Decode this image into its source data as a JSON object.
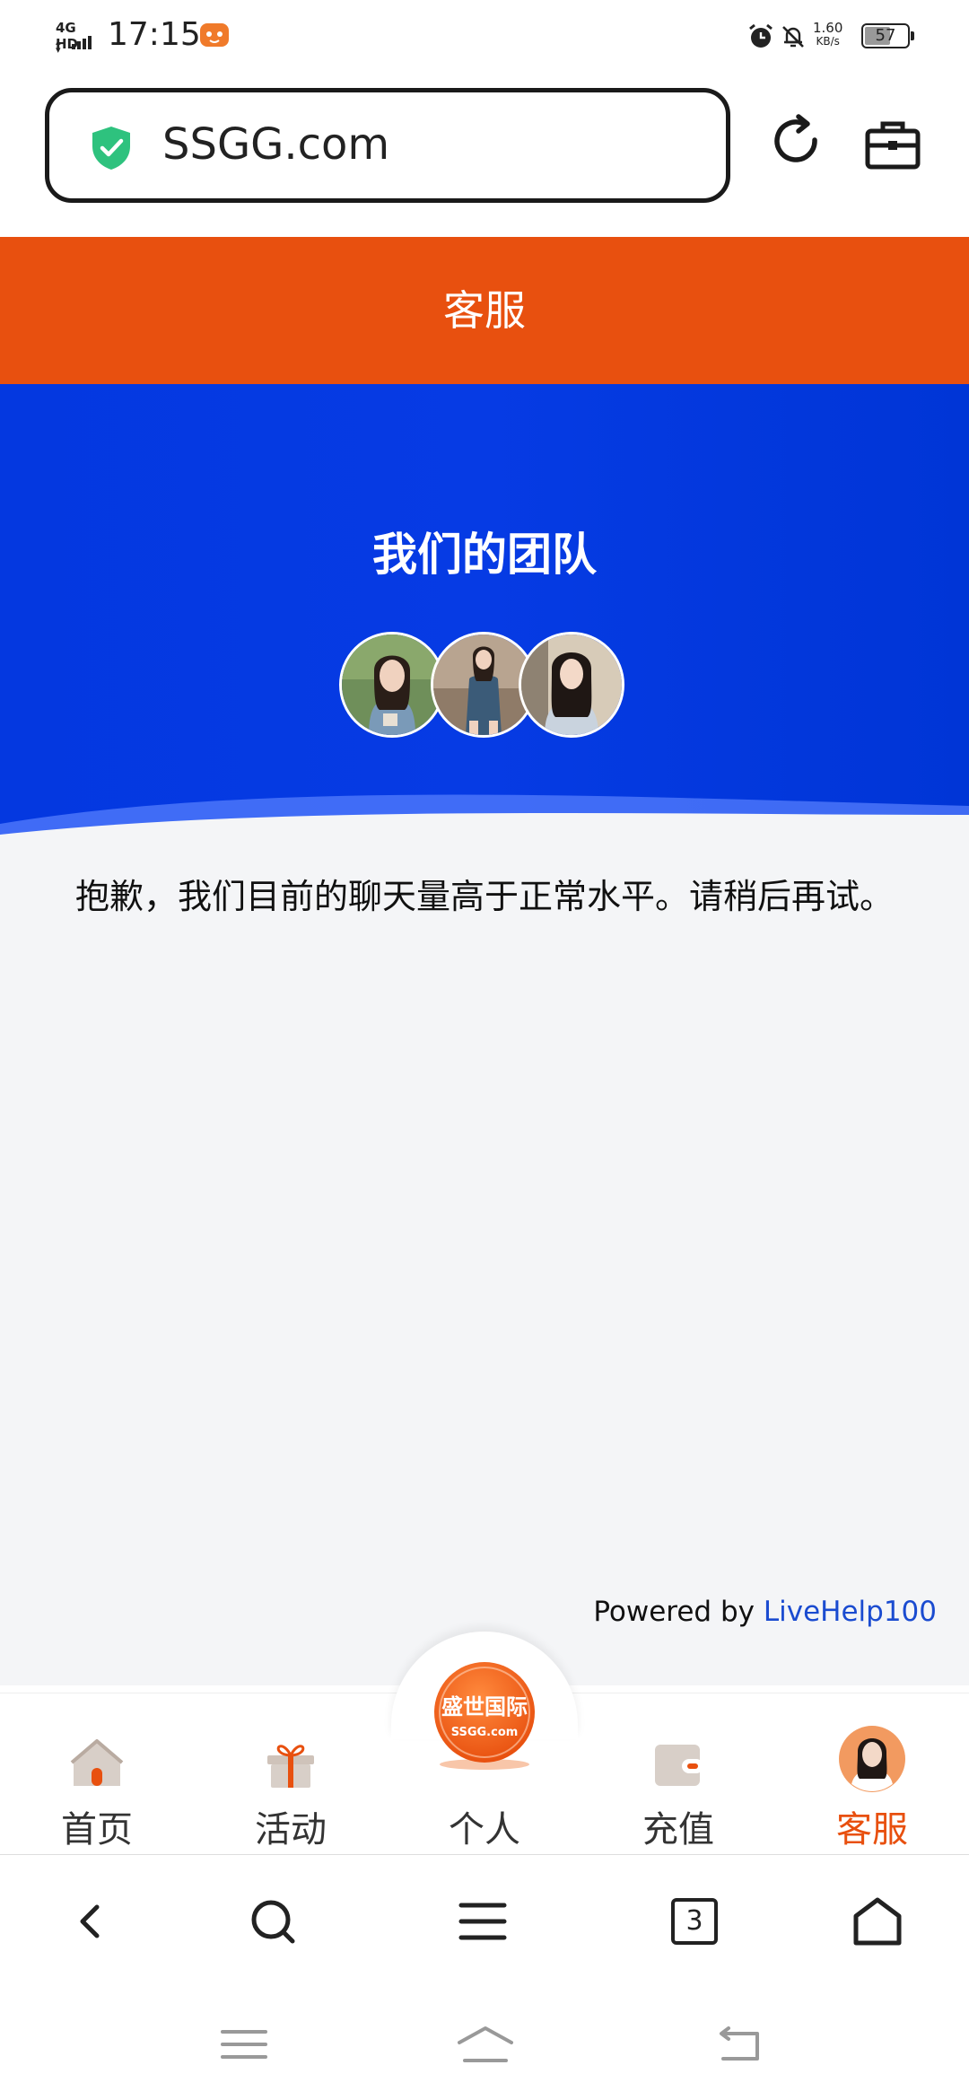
{
  "status_bar": {
    "network": "4G HD",
    "time": "17:15",
    "net_speed_value": "1.60",
    "net_speed_unit": "KB/s",
    "battery": "57"
  },
  "browser": {
    "url": "SSGG.com",
    "tab_count": "3"
  },
  "header": {
    "title": "客服"
  },
  "hero": {
    "title": "我们的团队"
  },
  "chat": {
    "notice": "抱歉，我们目前的聊天量高于正常水平。请稍后再试。",
    "powered_prefix": "Powered by ",
    "powered_brand": "LiveHelp100"
  },
  "tabbar": {
    "items": [
      {
        "label": "首页",
        "icon": "home-icon"
      },
      {
        "label": "活动",
        "icon": "gift-icon"
      },
      {
        "label": "个人",
        "icon": "logo-badge-icon"
      },
      {
        "label": "充值",
        "icon": "wallet-icon"
      },
      {
        "label": "客服",
        "icon": "support-avatar-icon",
        "active": true
      }
    ],
    "center_logo_line1": "盛世国际",
    "center_logo_line2": "SSGG.com"
  },
  "colors": {
    "accent": "#e8500f",
    "hero_blue": "#0438e0",
    "link_blue": "#1a4bd0"
  }
}
